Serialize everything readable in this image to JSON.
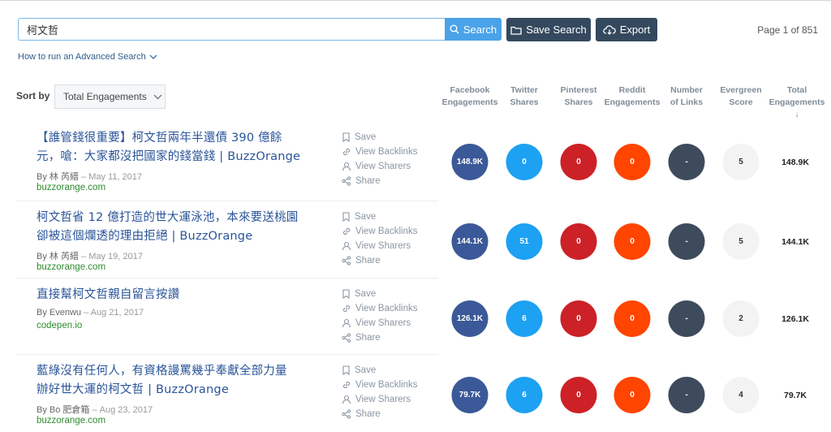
{
  "search": {
    "value": "柯文哲",
    "button_label": "Search"
  },
  "toolbar": {
    "save_search_label": "Save Search",
    "export_label": "Export"
  },
  "pagination": {
    "text": "Page 1 of 851"
  },
  "advanced_search": {
    "label": "How to run an Advanced Search"
  },
  "sort": {
    "label": "Sort by",
    "selected": "Total Engagements"
  },
  "columns": {
    "facebook": [
      "Facebook",
      "Engagements"
    ],
    "twitter": [
      "Twitter",
      "Shares"
    ],
    "pinterest": [
      "Pinterest",
      "Shares"
    ],
    "reddit": [
      "Reddit",
      "Engagements"
    ],
    "links": [
      "Number",
      "of Links"
    ],
    "evergreen": [
      "Evergreen",
      "Score"
    ],
    "total": [
      "Total",
      "Engagements ↓"
    ]
  },
  "action_labels": {
    "save": "Save",
    "backlinks": "View Backlinks",
    "sharers": "View Sharers",
    "share": "Share"
  },
  "results": [
    {
      "title_lines": [
        "【誰管錢很重要】柯文哲兩年半還債 390 億餘",
        "元，嗆：大家都沒把國家的錢當錢 | BuzzOrange"
      ],
      "by": "By 林 芮縉",
      "date": "May 11, 2017",
      "domain": "buzzorange.com",
      "facebook": "148.9K",
      "twitter": "0",
      "pinterest": "0",
      "reddit": "0",
      "links": "-",
      "evergreen": "5",
      "total": "148.9K"
    },
    {
      "title_lines": [
        "柯文哲省 12 億打造的世大運泳池，本來要送桃園",
        "卻被這個爛透的理由拒絕 | BuzzOrange"
      ],
      "by": "By 林 芮縉",
      "date": "May 19, 2017",
      "domain": "buzzorange.com",
      "facebook": "144.1K",
      "twitter": "51",
      "pinterest": "0",
      "reddit": "0",
      "links": "-",
      "evergreen": "5",
      "total": "144.1K"
    },
    {
      "title_lines": [
        "直接幫柯文哲親自留言按讚"
      ],
      "by": "By Evenwu",
      "date": "Aug 21, 2017",
      "domain": "codepen.io",
      "facebook": "126.1K",
      "twitter": "6",
      "pinterest": "0",
      "reddit": "0",
      "links": "-",
      "evergreen": "2",
      "total": "126.1K"
    },
    {
      "title_lines": [
        "藍綠沒有任何人，有資格謾罵幾乎奉獻全部力量",
        "辦好世大運的柯文哲 | BuzzOrange"
      ],
      "by": "By Bo 肥倉箱",
      "date": "Aug 23, 2017",
      "domain": "buzzorange.com",
      "facebook": "79.7K",
      "twitter": "6",
      "pinterest": "0",
      "reddit": "0",
      "links": "-",
      "evergreen": "4",
      "total": "79.7K"
    }
  ],
  "colors": {
    "accent": "#4aa3e8",
    "dark_button": "#34495e",
    "facebook": "#3b5998",
    "twitter": "#1da1f2",
    "pinterest": "#cc2127",
    "reddit": "#ff4500"
  }
}
